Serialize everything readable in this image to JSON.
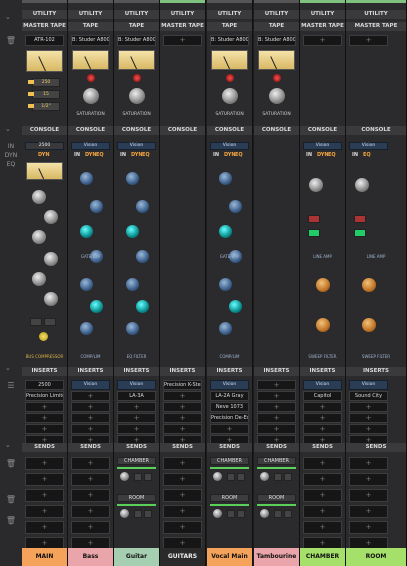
{
  "colors": {
    "background": "#1c1c1e",
    "strip": "#2b2b2d",
    "main": "#f5a25a",
    "bass": "#e9a5a9",
    "guitar": "#a6ceb0",
    "guitars": "#2a2a2a",
    "vocal_main": "#f5a25a",
    "tambourine": "#e9a5a9",
    "chamber": "#a5e06a",
    "room": "#a5e06a",
    "accent_green": "#5ad05a"
  },
  "gutter": {
    "dyn_label": "DYN",
    "in_label": "IN",
    "eq_label": "EQ"
  },
  "strips": [
    {
      "id": "main",
      "name": "MAIN",
      "top": "UTILITY",
      "tape_header": "MASTER TAPE",
      "tape_model": "ATR-102",
      "tape_values": [
        "250",
        "15",
        "1/2\""
      ],
      "console_header": "CONSOLE",
      "console_label": "2500",
      "console_mode": "DYN",
      "console_footer": "BUS COMPRESSOR",
      "inserts_header": "INSERTS",
      "inserts": [
        "2500",
        "Precision Limiter",
        "",
        "",
        "",
        ""
      ],
      "sends_header": "SENDS",
      "sends": [],
      "send_slots": 6
    },
    {
      "id": "bass",
      "name": "Bass",
      "top": "UTILITY",
      "tape_header": "TAPE",
      "tape_model": "B: Studer A800",
      "tape_knob": "SATURATION",
      "console_header": "CONSOLE",
      "console_label": "Vision",
      "console_modes": [
        "IN",
        "DYN",
        "EQ"
      ],
      "console_footer_left": "GATE/EXP",
      "console_footer_right": "COMP/LIM",
      "inserts_header": "INSERTS",
      "inserts": [
        "Vision",
        "",
        "",
        "",
        "",
        ""
      ],
      "sends_header": "SENDS",
      "sends": [],
      "send_slots": 6
    },
    {
      "id": "guitar",
      "name": "Guitar",
      "top": "UTILITY",
      "tape_header": "TAPE",
      "tape_model": "B: Studer A800",
      "tape_knob": "SATURATION",
      "console_header": "CONSOLE",
      "console_label": "Vision",
      "console_modes": [
        "IN",
        "DYN",
        "EQ"
      ],
      "console_footer": "EQ FILTER",
      "inserts_header": "INSERTS",
      "inserts": [
        "Vision",
        "LA-3A",
        "",
        "",
        "",
        ""
      ],
      "sends_header": "SENDS",
      "sends": [
        "CHAMBER",
        "ROOM"
      ],
      "send_slots": 0
    },
    {
      "id": "guitars",
      "name": "GUITARS",
      "top": "UTILITY",
      "tape_header": "MASTER TAPE",
      "console_header": "CONSOLE",
      "inserts_header": "INSERTS",
      "inserts": [
        "Precision K-Stereo",
        "",
        "",
        "",
        "",
        ""
      ],
      "sends_header": "SENDS",
      "sends": [],
      "send_slots": 6
    },
    {
      "id": "vocal_main",
      "name": "Vocal Main",
      "top": "UTILITY",
      "tape_header": "TAPE",
      "tape_model": "B: Studer A800",
      "tape_knob": "SATURATION",
      "console_header": "CONSOLE",
      "console_label": "Vision",
      "console_modes": [
        "IN",
        "DYN",
        "EQ"
      ],
      "console_footer_left": "GATE/EXP",
      "console_footer_right": "COMP/LIM",
      "inserts_header": "INSERTS",
      "inserts": [
        "Vision",
        "LA-2A Gray",
        "Neve 1073",
        "Precision De-Esser",
        "",
        ""
      ],
      "sends_header": "SENDS",
      "sends": [
        "CHAMBER",
        "ROOM"
      ],
      "send_slots": 0
    },
    {
      "id": "tambourine",
      "name": "Tambourine",
      "top": "UTILITY",
      "tape_header": "TAPE",
      "tape_model": "B: Studer A800",
      "tape_knob": "SATURATION",
      "console_header": "CONSOLE",
      "inserts_header": "INSERTS",
      "inserts": [
        "",
        "",
        "",
        "",
        "",
        ""
      ],
      "sends_header": "SENDS",
      "sends": [
        "CHAMBER",
        "ROOM"
      ],
      "send_slots": 0
    },
    {
      "id": "chamber",
      "name": "CHAMBER",
      "top": "UTILITY",
      "tape_header": "MASTER TAPE",
      "console_header": "CONSOLE",
      "console_label": "Vision",
      "console_modes": [
        "IN",
        "DYN",
        "EQ"
      ],
      "console_footer_top": "LINE AMP",
      "console_footer": "SWEEP FILTER",
      "inserts_header": "INSERTS",
      "inserts": [
        "Vision",
        "Capitol",
        "",
        "",
        "",
        ""
      ],
      "sends_header": "SENDS",
      "sends": [],
      "send_slots": 6
    },
    {
      "id": "room",
      "name": "ROOM",
      "top": "UTILITY",
      "tape_header": "MASTER TAPE",
      "console_header": "CONSOLE",
      "console_label": "Vision",
      "console_modes": [
        "IN",
        "EQ"
      ],
      "console_footer_top": "LINE AMP",
      "console_footer": "SWEEP FILTER",
      "inserts_header": "INSERTS",
      "inserts": [
        "Vision",
        "Sound City",
        "",
        "",
        "",
        ""
      ],
      "sends_header": "SENDS",
      "sends": [],
      "send_slots": 6
    }
  ],
  "plus": "+"
}
